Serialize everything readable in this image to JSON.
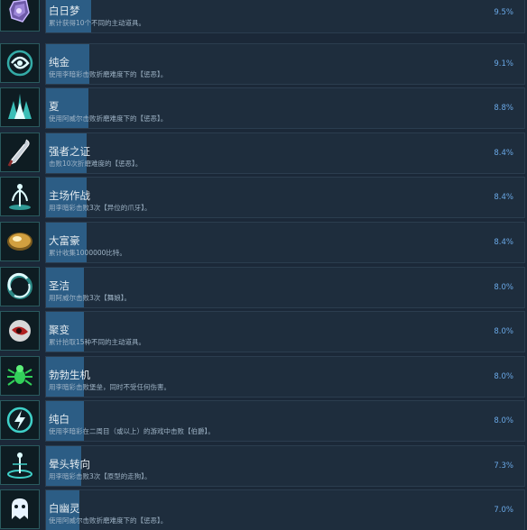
{
  "colors": {
    "background": "#1b2838",
    "bar": "#1e2d3d",
    "fill": "#2c5d85",
    "percent": "#6aa8e6",
    "icon_glow": "#3fd0c8"
  },
  "achievements": [
    {
      "title": "白日梦",
      "description": "累计获得10个不同的主动道具。",
      "percent": "9.5%",
      "progress": 0.095,
      "icon": "crystal-icon"
    },
    {
      "title": "纯金",
      "description": "使用李暗彩击败折磨难度下的【惩恶】。",
      "percent": "9.1%",
      "progress": 0.091,
      "icon": "swirl-icon"
    },
    {
      "title": "夏",
      "description": "使用阿威尔击败折磨难度下的【惩恶】。",
      "percent": "8.8%",
      "progress": 0.088,
      "icon": "spikes-icon"
    },
    {
      "title": "强者之证",
      "description": "击败10次折磨难度的【惩恶】。",
      "percent": "8.4%",
      "progress": 0.084,
      "icon": "blade-icon"
    },
    {
      "title": "主场作战",
      "description": "用李暗彩击败3次【异位的爪牙】。",
      "percent": "8.4%",
      "progress": 0.084,
      "icon": "fountain-icon"
    },
    {
      "title": "大富豪",
      "description": "累计收集1000000比特。",
      "percent": "8.4%",
      "progress": 0.084,
      "icon": "coin-icon"
    },
    {
      "title": "圣洁",
      "description": "用阿威尔击败3次【舞娘】。",
      "percent": "8.0%",
      "progress": 0.08,
      "icon": "ring-icon"
    },
    {
      "title": "聚变",
      "description": "累计拾取15种不同的主动道具。",
      "percent": "8.0%",
      "progress": 0.08,
      "icon": "orb-icon"
    },
    {
      "title": "勃勃生机",
      "description": "用李暗彩击败堡垒，同时不受任何伤害。",
      "percent": "8.0%",
      "progress": 0.08,
      "icon": "spider-icon"
    },
    {
      "title": "纯白",
      "description": "使用李暗彩在二周目（或以上）的游戏中击败【伯爵】。",
      "percent": "8.0%",
      "progress": 0.08,
      "icon": "lightning-ring-icon"
    },
    {
      "title": "晕头转向",
      "description": "用李暗彩击败3次【原型的走狗】。",
      "percent": "7.3%",
      "progress": 0.073,
      "icon": "beacon-icon"
    },
    {
      "title": "白幽灵",
      "description": "使用阿威尔击败折磨难度下的【惩恶】。",
      "percent": "7.0%",
      "progress": 0.07,
      "icon": "ghost-icon"
    }
  ]
}
